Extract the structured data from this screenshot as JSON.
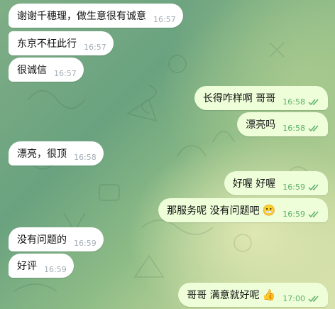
{
  "theme": {
    "incoming_bubble": "#ffffff",
    "outgoing_bubble": "#eefed9",
    "outgoing_time": "#5fb06a",
    "incoming_time": "#a5aeb4"
  },
  "messages": [
    {
      "dir": "in",
      "text": "谢谢千穗理，做生意很有诚意",
      "time": "16:57"
    },
    {
      "dir": "in",
      "text": "东京不枉此行",
      "time": "16:57"
    },
    {
      "dir": "in",
      "text": "很诚信",
      "time": "16:57"
    },
    {
      "dir": "out",
      "text": "长得咋样啊 哥哥",
      "time": "16:58",
      "status": "read-double-check-icon"
    },
    {
      "dir": "out",
      "text": "漂亮吗",
      "time": "16:58",
      "status": "read-double-check-icon"
    },
    {
      "dir": "in",
      "text": "漂亮，很顶",
      "time": "16:58"
    },
    {
      "dir": "out",
      "text": "好喔 好喔",
      "time": "16:59",
      "status": "read-double-check-icon"
    },
    {
      "dir": "out",
      "text": "那服务呢 没有问题吧",
      "emoji": "😬",
      "time": "16:59",
      "status": "read-double-check-icon"
    },
    {
      "dir": "in",
      "text": "没有问题的",
      "time": "16:59"
    },
    {
      "dir": "in",
      "text": "好评",
      "time": "16:59"
    },
    {
      "dir": "out",
      "text": "哥哥 满意就好呢",
      "emoji": "👍",
      "time": "17:00",
      "status": "read-double-check-icon"
    }
  ]
}
